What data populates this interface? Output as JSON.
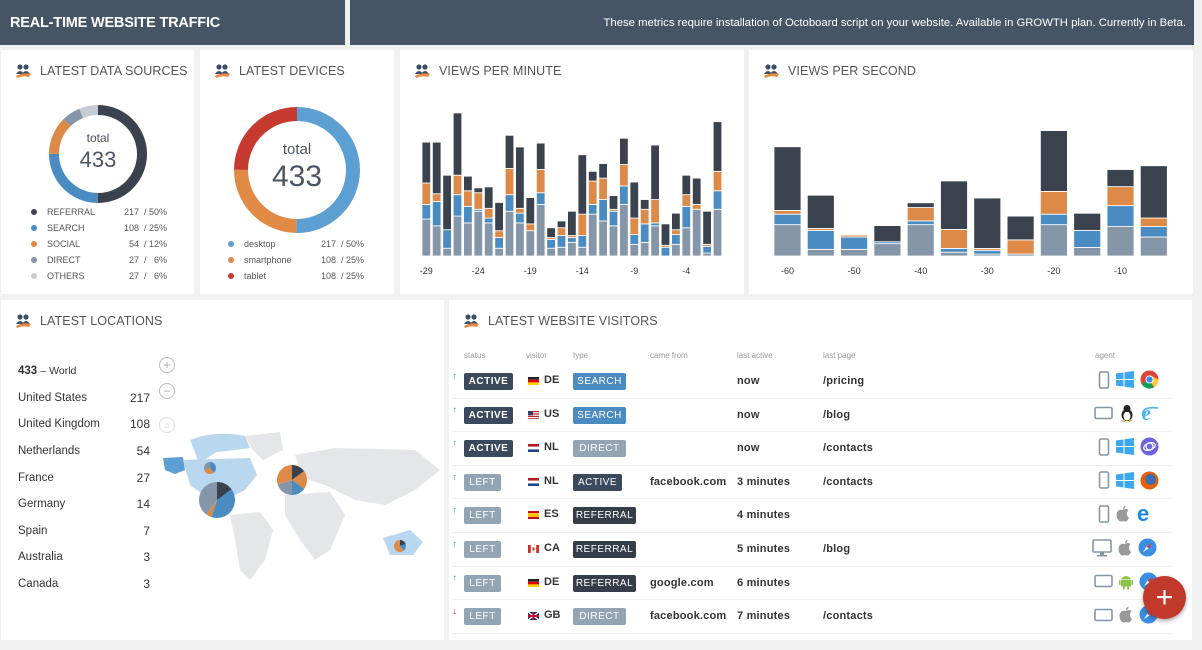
{
  "header": {
    "title": "REAL-TIME WEBSITE TRAFFIC",
    "notice": "These metrics require installation of Octoboard script on your website. Available in GROWTH plan. Currently in Beta."
  },
  "colors": {
    "dark": "#3a424d",
    "blue": "#4a8cc2",
    "orange": "#dd8a48",
    "gray": "#8596a8",
    "lightgray": "#c4cbd2",
    "red": "#c63a2f",
    "desktop": "#5b9fd3",
    "smartphone": "#e08a46",
    "tablet": "#c63a2f"
  },
  "data_sources": {
    "title": "LATEST DATA SOURCES",
    "total_label": "total",
    "total": "433",
    "items": [
      {
        "label": "REFERRAL",
        "value": 217,
        "display": "217  / 50%",
        "color": "#3a424d"
      },
      {
        "label": "SEARCH",
        "value": 108,
        "display": "108  / 25%",
        "color": "#4a8cc2"
      },
      {
        "label": "SOCIAL",
        "value": 54,
        "display": "54  / 12%",
        "color": "#dd8a48"
      },
      {
        "label": "DIRECT",
        "value": 27,
        "display": "27  /   6%",
        "color": "#8596a8"
      },
      {
        "label": "OTHERS",
        "value": 27,
        "display": "27  /   6%",
        "color": "#c4cbd2"
      }
    ]
  },
  "devices": {
    "title": "LATEST DEVICES",
    "total_label": "total",
    "total": "433",
    "items": [
      {
        "label": "desktop",
        "value": 217,
        "display": "217  / 50%",
        "color": "#5b9fd3"
      },
      {
        "label": "smartphone",
        "value": 108,
        "display": "108  / 25%",
        "color": "#e08a46"
      },
      {
        "label": "tablet",
        "value": 108,
        "display": "108  / 25%",
        "color": "#c63a2f"
      }
    ]
  },
  "chart_data": [
    {
      "type": "bar",
      "stacked": true,
      "title": "VIEWS PER MINUTE",
      "x": [
        -29,
        -28,
        -27,
        -26,
        -25,
        -24,
        -23,
        -22,
        -21,
        -20,
        -19,
        -18,
        -17,
        -16,
        -15,
        -14,
        -13,
        -12,
        -11,
        -10,
        -9,
        -8,
        -7,
        -6,
        -5,
        -4,
        -3,
        -2,
        -1
      ],
      "tick_labels": [
        "-29",
        "-24",
        "-19",
        "-14",
        "-9",
        "-4"
      ],
      "series": [
        {
          "name": "direct",
          "color": "#8596a8",
          "values": [
            38,
            31,
            8,
            41,
            34,
            46,
            34,
            8,
            46,
            34,
            26,
            53,
            8,
            9,
            14,
            9,
            43,
            36,
            31,
            53,
            12,
            14,
            31,
            0,
            12,
            29,
            48,
            3,
            48
          ]
        },
        {
          "name": "search",
          "color": "#4a8cc2",
          "values": [
            15,
            25,
            19,
            22,
            17,
            2,
            5,
            11,
            17,
            10,
            0,
            12,
            9,
            12,
            5,
            12,
            10,
            22,
            15,
            19,
            10,
            19,
            3,
            9,
            10,
            22,
            0,
            7,
            19
          ]
        },
        {
          "name": "social",
          "color": "#dd8a48",
          "values": [
            22,
            8,
            0,
            20,
            16,
            17,
            10,
            7,
            27,
            5,
            7,
            24,
            2,
            8,
            2,
            22,
            24,
            22,
            2,
            22,
            17,
            15,
            24,
            2,
            5,
            12,
            5,
            2,
            20
          ]
        },
        {
          "name": "referral",
          "color": "#3a424d",
          "values": [
            42,
            53,
            56,
            64,
            15,
            5,
            22,
            29,
            34,
            63,
            27,
            27,
            10,
            7,
            25,
            61,
            10,
            15,
            14,
            27,
            37,
            10,
            56,
            22,
            17,
            20,
            27,
            34,
            51
          ]
        }
      ],
      "ylim": [
        0,
        150
      ]
    },
    {
      "type": "bar",
      "stacked": true,
      "title": "VIEWS PER SECOND",
      "x": [
        -60,
        -55,
        -50,
        -45,
        -40,
        -35,
        -30,
        -25,
        -20,
        -15,
        -10,
        -5
      ],
      "tick_labels": [
        "-60",
        "-50",
        "-40",
        "-30",
        "-20",
        "-10"
      ],
      "series": [
        {
          "name": "direct",
          "color": "#8596a8",
          "values": [
            33,
            7,
            7,
            13,
            33,
            4,
            2,
            2,
            33,
            9,
            31,
            20
          ]
        },
        {
          "name": "search",
          "color": "#4a8cc2",
          "values": [
            11,
            20,
            13,
            2,
            4,
            4,
            4,
            0,
            11,
            18,
            22,
            11
          ]
        },
        {
          "name": "social",
          "color": "#dd8a48",
          "values": [
            4,
            2,
            2,
            0,
            14,
            20,
            2,
            15,
            24,
            0,
            20,
            9
          ]
        },
        {
          "name": "referral",
          "color": "#3a424d",
          "values": [
            67,
            35,
            0,
            17,
            5,
            51,
            53,
            25,
            64,
            18,
            18,
            55
          ]
        }
      ],
      "ylim": [
        0,
        140
      ]
    }
  ],
  "locations": {
    "title": "LATEST LOCATIONS",
    "world": {
      "count": "433",
      "label": "– World"
    },
    "items": [
      {
        "country": "United States",
        "count": "217"
      },
      {
        "country": "United Kingdom",
        "count": "108"
      },
      {
        "country": "Netherlands",
        "count": "54"
      },
      {
        "country": "France",
        "count": "27"
      },
      {
        "country": "Germany",
        "count": "14"
      },
      {
        "country": "Spain",
        "count": "7"
      },
      {
        "country": "Australia",
        "count": "3"
      },
      {
        "country": "Canada",
        "count": "3"
      }
    ],
    "map_controls": {
      "zoom_in": "+",
      "zoom_out": "−",
      "home": "⌂"
    }
  },
  "visitors": {
    "title": "LATEST WEBSITE VISITORS",
    "columns": [
      "status",
      "visitor",
      "type",
      "came from",
      "last active",
      "last page",
      "agent"
    ],
    "rows": [
      {
        "trend": "up",
        "status": "ACTIVE",
        "country": "DE",
        "type": "SEARCH",
        "came_from": "",
        "last_active": "now",
        "last_page": "/pricing",
        "device": "smartphone",
        "os": "windows",
        "browser": "chrome"
      },
      {
        "trend": "up",
        "status": "ACTIVE",
        "country": "US",
        "type": "SEARCH",
        "came_from": "",
        "last_active": "now",
        "last_page": "/blog",
        "device": "tablet",
        "os": "linux",
        "browser": "ie"
      },
      {
        "trend": "up",
        "status": "ACTIVE",
        "country": "NL",
        "type": "DIRECT",
        "came_from": "",
        "last_active": "now",
        "last_page": "/contacts",
        "device": "smartphone",
        "os": "windows",
        "browser": "samsung"
      },
      {
        "trend": "up",
        "status": "LEFT",
        "country": "NL",
        "type": "ACTIVE",
        "came_from": "facebook.com",
        "last_active": "3 minutes",
        "last_page": "/contacts",
        "device": "smartphone",
        "os": "windows",
        "browser": "firefox"
      },
      {
        "trend": "up",
        "status": "LEFT",
        "country": "ES",
        "type": "REFERRAL",
        "came_from": "",
        "last_active": "4 minutes",
        "last_page": "",
        "device": "smartphone",
        "os": "apple",
        "browser": "edge"
      },
      {
        "trend": "up",
        "status": "LEFT",
        "country": "CA",
        "type": "REFERRAL",
        "came_from": "",
        "last_active": "5 minutes",
        "last_page": "/blog",
        "device": "desktop",
        "os": "apple",
        "browser": "safari"
      },
      {
        "trend": "up",
        "status": "LEFT",
        "country": "DE",
        "type": "REFERRAL",
        "came_from": "google.com",
        "last_active": "6 minutes",
        "last_page": "",
        "device": "tablet",
        "os": "android",
        "browser": "safari"
      },
      {
        "trend": "down",
        "status": "LEFT",
        "country": "GB",
        "type": "DIRECT",
        "came_from": "facebook.com",
        "last_active": "7 minutes",
        "last_page": "/contacts",
        "device": "tablet",
        "os": "apple",
        "browser": "safari"
      }
    ]
  },
  "fab": {
    "label": "+"
  }
}
